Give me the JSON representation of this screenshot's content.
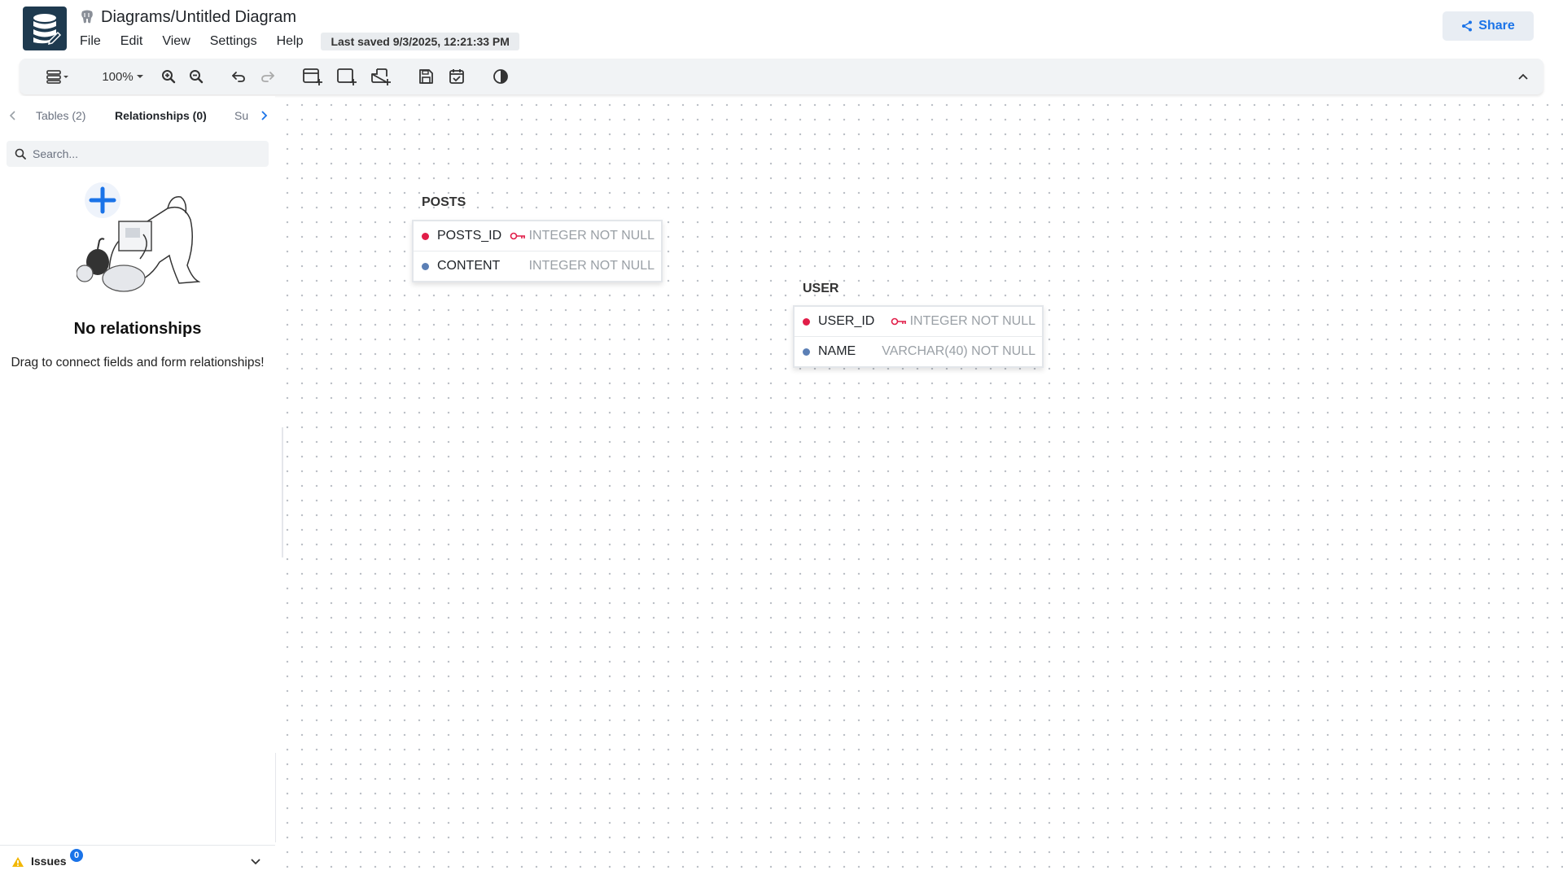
{
  "header": {
    "title": "Diagrams/Untitled Diagram",
    "menu": [
      "File",
      "Edit",
      "View",
      "Settings",
      "Help"
    ],
    "last_saved": "Last saved 9/3/2025, 12:21:33 PM",
    "share_label": "Share"
  },
  "toolbar": {
    "zoom_level": "100%"
  },
  "sidebar": {
    "tabs": [
      {
        "label": "Tables (2)"
      },
      {
        "label": "Relationships (0)"
      },
      {
        "label": "Su"
      }
    ],
    "search_placeholder": "Search...",
    "empty_title": "No relationships",
    "empty_subtitle": "Drag to connect fields and form relationships!",
    "issues_label": "Issues",
    "issues_count": "0"
  },
  "canvas": {
    "tables": [
      {
        "name": "POSTS",
        "fields": [
          {
            "name": "POSTS_ID",
            "type": "INTEGER NOT NULL",
            "primary": true
          },
          {
            "name": "CONTENT",
            "type": "INTEGER NOT NULL",
            "primary": false
          }
        ]
      },
      {
        "name": "USER",
        "fields": [
          {
            "name": "USER_ID",
            "type": "INTEGER NOT NULL",
            "primary": true
          },
          {
            "name": "NAME",
            "type": "VARCHAR(40) NOT NULL",
            "primary": false
          }
        ]
      }
    ]
  },
  "colors": {
    "accent": "#1a73e8",
    "primary_key": "#e11d48",
    "field_dot": "#5b7fb5",
    "logo_bg": "#1e3a4f"
  }
}
